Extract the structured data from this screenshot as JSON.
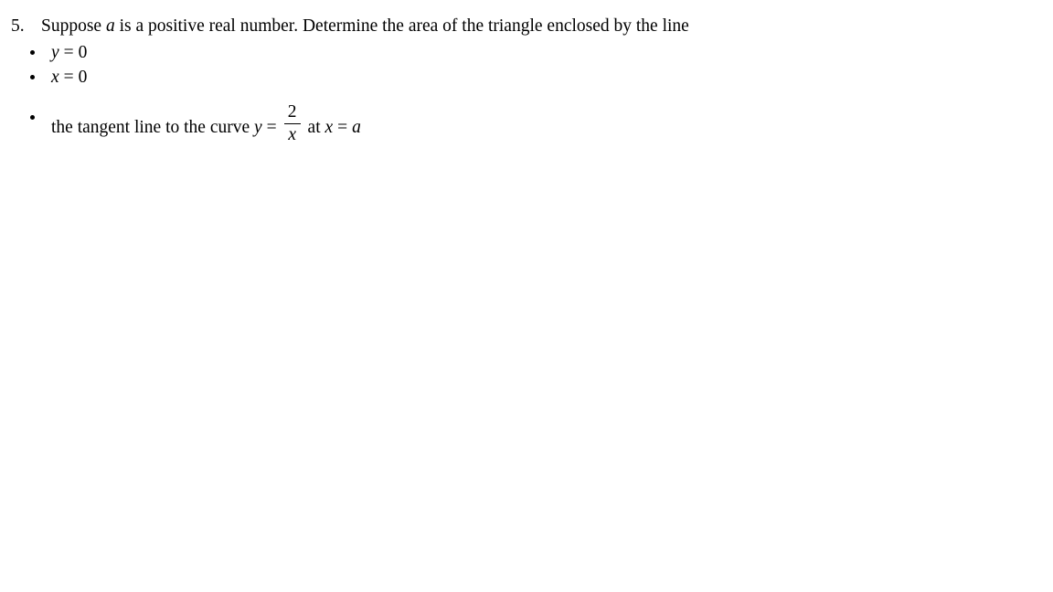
{
  "document": {
    "background_color": "#ffffff",
    "text_color": "#000000"
  },
  "problem": {
    "number": "5.",
    "stem_parts": {
      "before_var": "Suppose ",
      "variable": "a",
      "after_var": " is a positive real number. Determine the area of the triangle enclosed by the line"
    },
    "full_stem": "Suppose a is a positive real number. Determine the area of the triangle enclosed by the line",
    "bullets": [
      {
        "id": "bullet-y-equals-zero",
        "kind": "equation",
        "lhs": "y",
        "operator": "=",
        "rhs": "0",
        "text": "y = 0"
      },
      {
        "id": "bullet-x-equals-zero",
        "kind": "equation",
        "lhs": "x",
        "operator": "=",
        "rhs": "0",
        "text": "x = 0"
      },
      {
        "id": "bullet-tangent-line",
        "kind": "tangent-line",
        "lead_text": "the tangent line to the curve ",
        "curve_lhs": "y",
        "curve_operator": "=",
        "fraction": {
          "numerator": "2",
          "denominator": "x"
        },
        "at_word": "at",
        "point_lhs": "x",
        "point_operator": "=",
        "point_rhs": "a",
        "text": "the tangent line to the curve y = 2/x at x = a"
      }
    ]
  }
}
